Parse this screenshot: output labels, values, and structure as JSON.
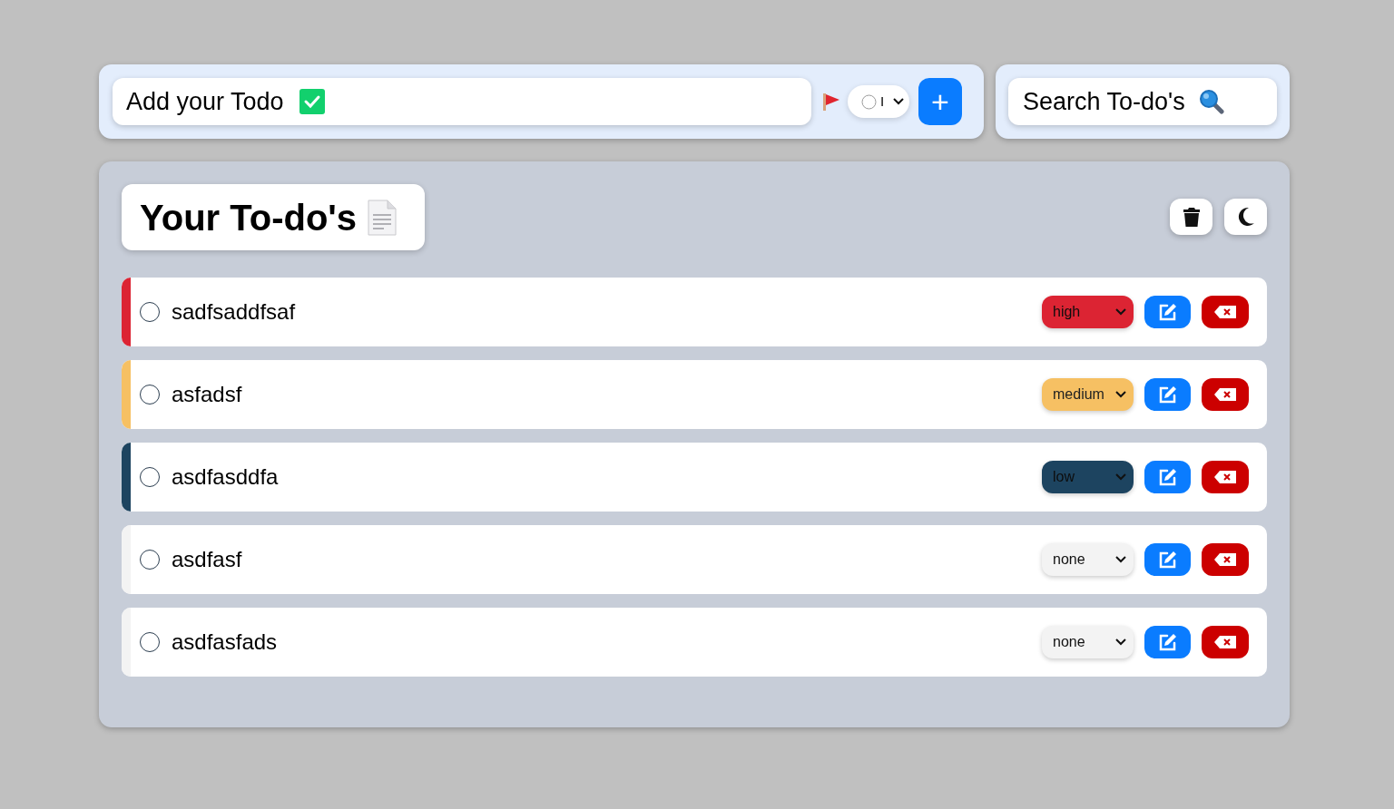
{
  "add_bar": {
    "placeholder": "Add your Todo",
    "priority_select": {
      "value": "I"
    },
    "add_button": "+"
  },
  "search": {
    "placeholder": "Search To-do's"
  },
  "panel": {
    "title": "Your To-do's"
  },
  "todos": [
    {
      "text": "sadfsaddfsaf",
      "checked": false,
      "priority": "high",
      "color": "#dc2433"
    },
    {
      "text": "asfadsf",
      "checked": false,
      "priority": "medium",
      "color": "#f6c063"
    },
    {
      "text": "asdfasddfa",
      "checked": false,
      "priority": "low",
      "color": "#1d4460"
    },
    {
      "text": "asdfasf",
      "checked": false,
      "priority": "none",
      "color": "#f3f3f3"
    },
    {
      "text": "asdfasfads",
      "checked": false,
      "priority": "none",
      "color": "#f3f3f3"
    }
  ]
}
